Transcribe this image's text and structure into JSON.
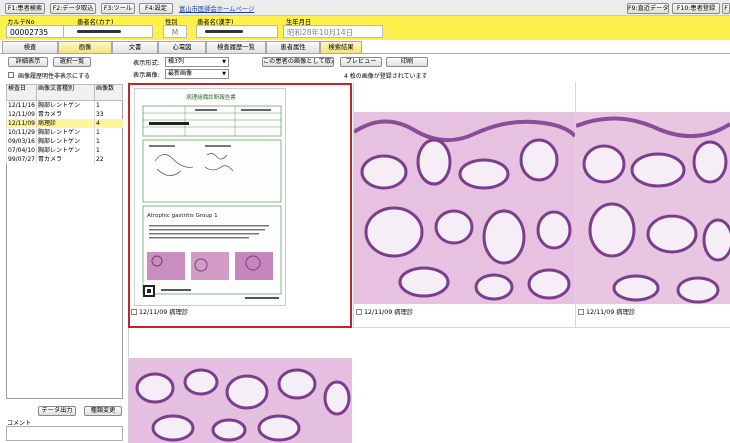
{
  "toolbar": {
    "patient_search": "F1:患者検索",
    "data_import": "F2:データ取込",
    "tools": "F3:ツール",
    "settings": "F4:設定",
    "homepage_link": "富山市医師会ホームページ",
    "recent_data": "F9:直近データ",
    "patient_register": "F10:患者登録",
    "extra": "F"
  },
  "patient": {
    "chart_no_label": "カルテNo",
    "chart_no": "00002735",
    "kana_label": "患者名(カナ)",
    "kana_value": "",
    "sex_label": "性別",
    "sex": "M",
    "kanji_label": "患者名(漢字)",
    "kanji_value": "",
    "dob_label": "生年月日",
    "dob": "昭和28年10月14日"
  },
  "tabs": [
    "検査",
    "画像",
    "文書",
    "心電図",
    "検査履歴一覧",
    "患者属性",
    "検索結果"
  ],
  "left": {
    "detail_btn": "詳細表示",
    "select_list_btn": "選択一覧",
    "hide_history_label": "画像履歴明性非表示にする",
    "col_date": "検査日",
    "col_type": "画像文書種別",
    "col_count": "画像数",
    "rows": [
      {
        "date": "12/11/16",
        "type": "胸部レントゲン",
        "count": "1"
      },
      {
        "date": "12/11/09",
        "type": "胃カメラ",
        "count": "33"
      },
      {
        "date": "12/11/09",
        "type": "病理診",
        "count": "4"
      },
      {
        "date": "10/11/29",
        "type": "胸部レントゲン",
        "count": "1"
      },
      {
        "date": "09/03/16",
        "type": "胸部レントゲン",
        "count": "1"
      },
      {
        "date": "07/04/10",
        "type": "胸部レントゲン",
        "count": "1"
      },
      {
        "date": "99/07/27",
        "type": "胃カメラ",
        "count": "22"
      }
    ],
    "export_btn": "データ出力",
    "history_change_btn": "種類変更",
    "comment_label": "コメント"
  },
  "view": {
    "display_format_label": "表示形式:",
    "display_format": "横3列",
    "display_image_label": "表示画像:",
    "display_image": "最新画像",
    "take_as_patient_image": "この患者の画像として取込",
    "preview": "プレビュー",
    "print": "印刷",
    "registered_count": "4 枚の画像が登録されています"
  },
  "report": {
    "title": "病理組織診断報告書",
    "diagnosis": "Atrophic gastritis Group 1"
  },
  "captions": [
    "12/11/09 病理診",
    "12/11/09 病理診",
    "12/11/09 病理診"
  ],
  "colors": {
    "toolbar": "#ececec",
    "patient_band": "#fff14d",
    "selected_tab": "#f6e27a",
    "highlight_row": "#fff59a",
    "selection_frame": "#c0272d"
  }
}
